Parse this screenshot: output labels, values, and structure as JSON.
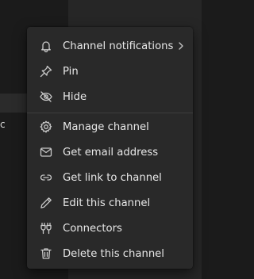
{
  "menu": {
    "items": [
      {
        "label": "Channel notifications",
        "icon": "bell-icon",
        "has_submenu": true
      },
      {
        "label": "Pin",
        "icon": "pin-icon"
      },
      {
        "label": "Hide",
        "icon": "eye-off-icon"
      },
      {
        "label": "Manage channel",
        "icon": "gear-icon"
      },
      {
        "label": "Get email address",
        "icon": "mail-icon"
      },
      {
        "label": "Get link to channel",
        "icon": "link-icon"
      },
      {
        "label": "Edit this channel",
        "icon": "pencil-icon"
      },
      {
        "label": "Connectors",
        "icon": "plug-icon"
      },
      {
        "label": "Delete this channel",
        "icon": "trash-icon"
      }
    ]
  },
  "background": {
    "partial_text": "c"
  },
  "colors": {
    "menu_bg": "#292929",
    "text": "#e8e8e8",
    "icon": "#c9c9c9",
    "divider": "#3d3d3d"
  }
}
